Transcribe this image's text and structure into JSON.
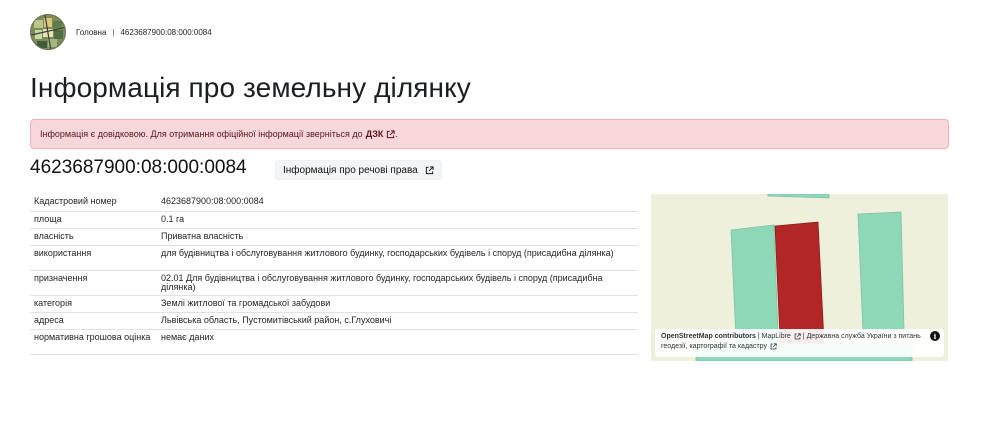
{
  "header": {
    "logo_icon": "land-map-logo-icon",
    "breadcrumb": {
      "home_label": "Головна",
      "separator": "|",
      "current_label": "4623687900:08:000:0084"
    }
  },
  "page": {
    "title": "Інформація про земельну ділянку"
  },
  "alert": {
    "text": "Інформація є довідковою. Для отримання офіційної інформації зверніться до",
    "link_label": "ДЗК",
    "trailing": ".",
    "color_bg": "#f8d7da"
  },
  "parcel": {
    "cadastral_heading": "4623687900:08:000:0084",
    "rights_button_label": "Інформація про речові права"
  },
  "details": [
    {
      "key": "Кадастровий номер",
      "value": "4623687900:08:000:0084"
    },
    {
      "key": "площа",
      "value": "0.1 га"
    },
    {
      "key": "власність",
      "value": "Приватна власність"
    },
    {
      "key": "використання",
      "value": "для будівництва і обслуговування житлового будинку, господарських будівель і споруд (присадибна ділянка)"
    },
    {
      "key": "призначення",
      "value": "02.01 Для будівництва і обслуговування житлового будинку, господарських будівель і споруд (присадибна ділянка)"
    },
    {
      "key": "категорія",
      "value": "Землі житлової та громадської забудови"
    },
    {
      "key": "адреса",
      "value": "Львівська область, Пустомитівський район, с.Глуховичі"
    },
    {
      "key": "нормативна грошова оцінка",
      "value": "немає даних"
    }
  ],
  "map": {
    "attribution": {
      "osm": "OpenStreetMap contributors",
      "sep1": "|",
      "maplibre": "MapLibre",
      "sep2": "|",
      "agency": "Державна служба України з питань геодезії, картографії та кадастру"
    },
    "info_icon": "info-icon",
    "colors": {
      "background": "#eef0dc",
      "parcels": "#8ed8b8",
      "selected_parcel": "#b22626"
    }
  }
}
